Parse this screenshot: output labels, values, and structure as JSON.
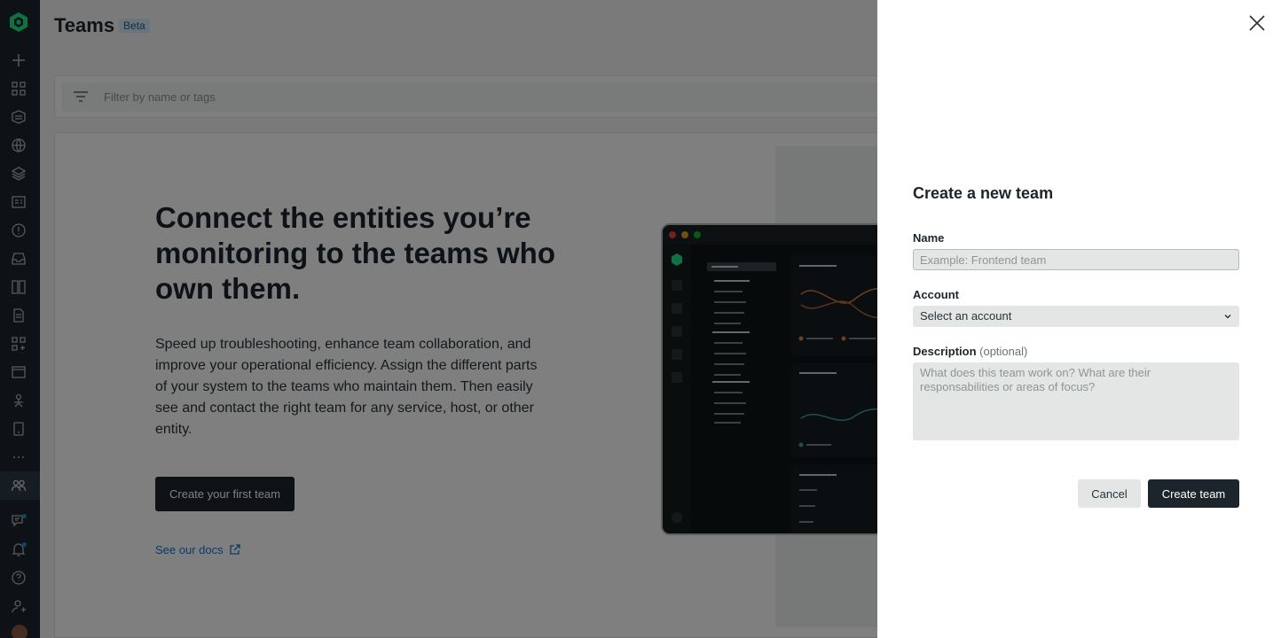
{
  "page": {
    "title": "Teams",
    "badge": "Beta",
    "filter_placeholder": "Filter by name or tags"
  },
  "hero": {
    "heading": "Connect the entities you’re monitoring to the teams who own them.",
    "body": "Speed up troubleshooting, enhance team collaboration, and improve your operational efficiency. Assign the different parts of your system to the teams who maintain them. Then easily see and contact the right team for any service, host, or other entity.",
    "cta_label": "Create your first team",
    "docs_link": "See our docs"
  },
  "nav": {
    "icons": [
      "add-data-icon",
      "all-capabilities-icon",
      "apm-icon",
      "browser-icon",
      "infrastructure-icon",
      "logs-icon",
      "alerts-icon",
      "inbox-icon",
      "dashboards-icon",
      "query-icon",
      "apps-icon",
      "catalog-icon",
      "synthetics-icon",
      "mobile-icon",
      "more-icon",
      "teams-icon",
      "help-chat-icon",
      "notifications-icon",
      "help-icon",
      "user-icon"
    ],
    "active": "teams-icon"
  },
  "drawer": {
    "title": "Create a new team",
    "name_label": "Name",
    "name_placeholder": "Example: Frontend team",
    "account_label": "Account",
    "account_value": "Select an account",
    "description_label": "Description",
    "description_optional": "(optional)",
    "description_placeholder": "What does this team work on? What are their responsabilities or areas of focus?",
    "cancel_label": "Cancel",
    "create_label": "Create team"
  },
  "colors": {
    "nav_bg": "#1d252c",
    "primary_button": "#1d252c",
    "link": "#0c74df",
    "brand_green": "#1ce783",
    "overlay": "rgba(0,0,0,0.5)"
  }
}
